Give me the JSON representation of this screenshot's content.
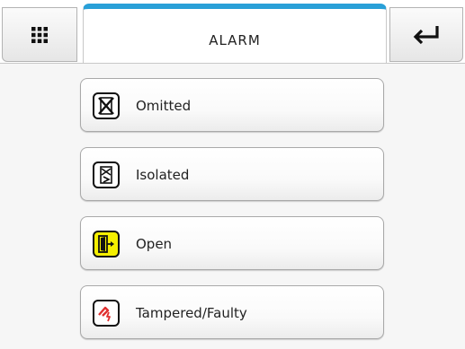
{
  "header": {
    "title": "ALARM",
    "menu_icon": "grid-icon",
    "back_icon": "enter-return-icon",
    "accent_color": "#29a0d8"
  },
  "items": [
    {
      "label": "Omitted",
      "icon": "omitted-icon",
      "icon_bg": "#ffffff"
    },
    {
      "label": "Isolated",
      "icon": "isolated-icon",
      "icon_bg": "#ffffff"
    },
    {
      "label": "Open",
      "icon": "open-door-icon",
      "icon_bg": "#f5ef00"
    },
    {
      "label": "Tampered/Faulty",
      "icon": "tamper-fault-icon",
      "icon_bg": "#ffffff",
      "icon_color": "#e03030"
    }
  ]
}
